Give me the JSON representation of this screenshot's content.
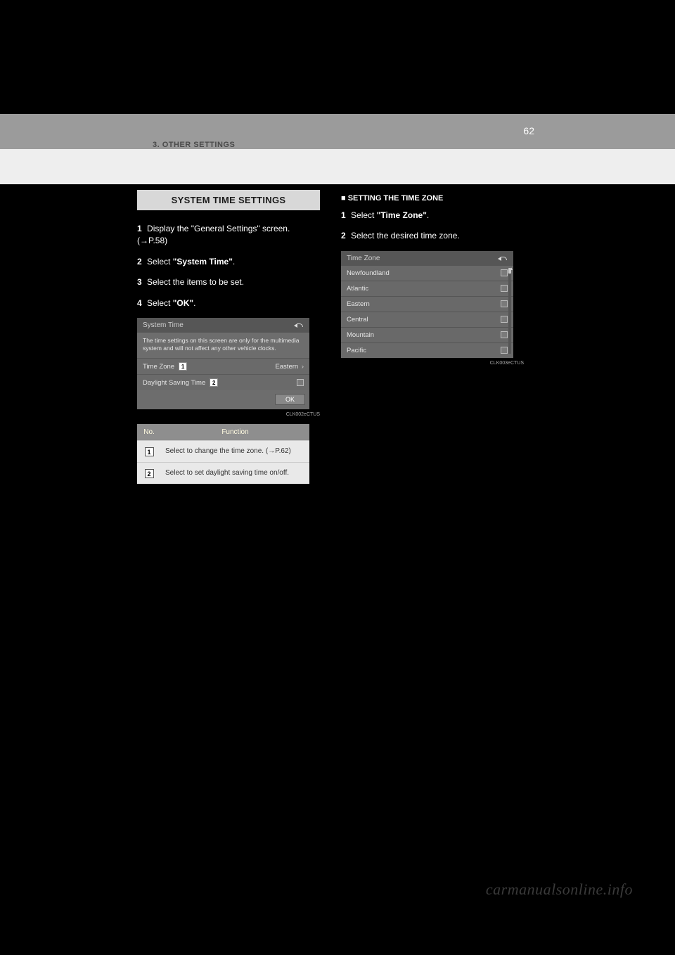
{
  "page_number": "62",
  "breadcrumb": "3. OTHER SETTINGS",
  "heading": "SYSTEM TIME SETTINGS",
  "left": {
    "step1": {
      "num": "1",
      "text": "Display the \"General Settings\" screen.",
      "ref": "(→P.58)"
    },
    "step2": {
      "num": "2",
      "text_a": "Select ",
      "quote": "\"System Time\"",
      "text_b": "."
    },
    "step3": {
      "num": "3",
      "text": "Select the items to be set."
    },
    "step4": {
      "num": "4",
      "text_a": "Select ",
      "quote": "\"OK\"",
      "text_b": "."
    }
  },
  "screen_sys": {
    "title": "System Time",
    "desc": "The time settings on this screen are only for the multimedia system and will not affect any other vehicle clocks.",
    "row_tz_label": "Time Zone",
    "row_tz_value": "Eastern",
    "row_dst_label": "Daylight Saving Time",
    "ok": "OK",
    "code": "CLK002eCTUS"
  },
  "func_table": {
    "col_no": "No.",
    "col_fn": "Function",
    "rows": [
      {
        "n": "1",
        "txt": "Select to change the time zone. (→P.62)"
      },
      {
        "n": "2",
        "txt": "Select to set daylight saving time on/off."
      }
    ]
  },
  "right": {
    "sub_heading": "■ SETTING THE TIME ZONE",
    "step1": {
      "num": "1",
      "text_a": "Select ",
      "quote": "\"Time Zone\"",
      "text_b": "."
    },
    "step2": {
      "num": "2",
      "text": "Select the desired time zone."
    }
  },
  "screen_tz": {
    "title": "Time Zone",
    "zones": [
      "Newfoundland",
      "Atlantic",
      "Eastern",
      "Central",
      "Mountain",
      "Pacific"
    ],
    "code": "CLK003eCTUS"
  },
  "watermark": "carmanualsonline.info"
}
